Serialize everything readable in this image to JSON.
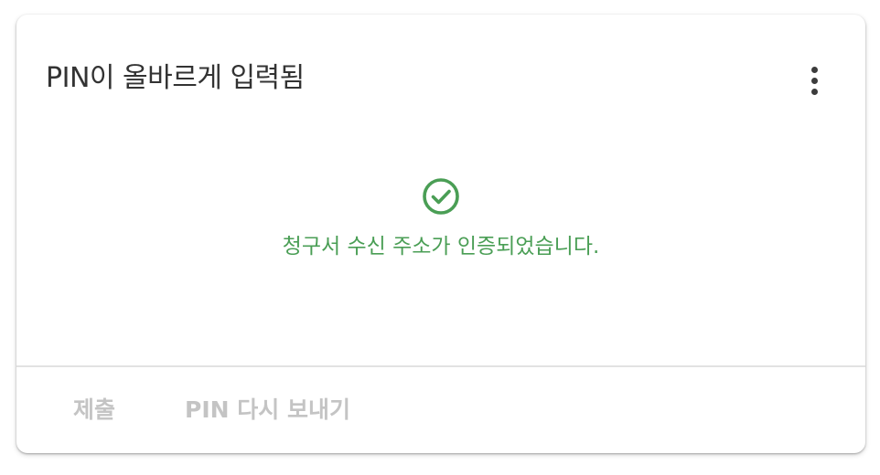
{
  "card": {
    "title": "PIN이 올바르게 입력됨",
    "menu_icon": "more-vertical-icon"
  },
  "status": {
    "icon": "check-circle-icon",
    "message": "청구서 수신 주소가 인증되었습니다.",
    "color": "#4a9e55"
  },
  "actions": {
    "submit_label": "제출",
    "resend_label": "PIN 다시 보내기"
  }
}
